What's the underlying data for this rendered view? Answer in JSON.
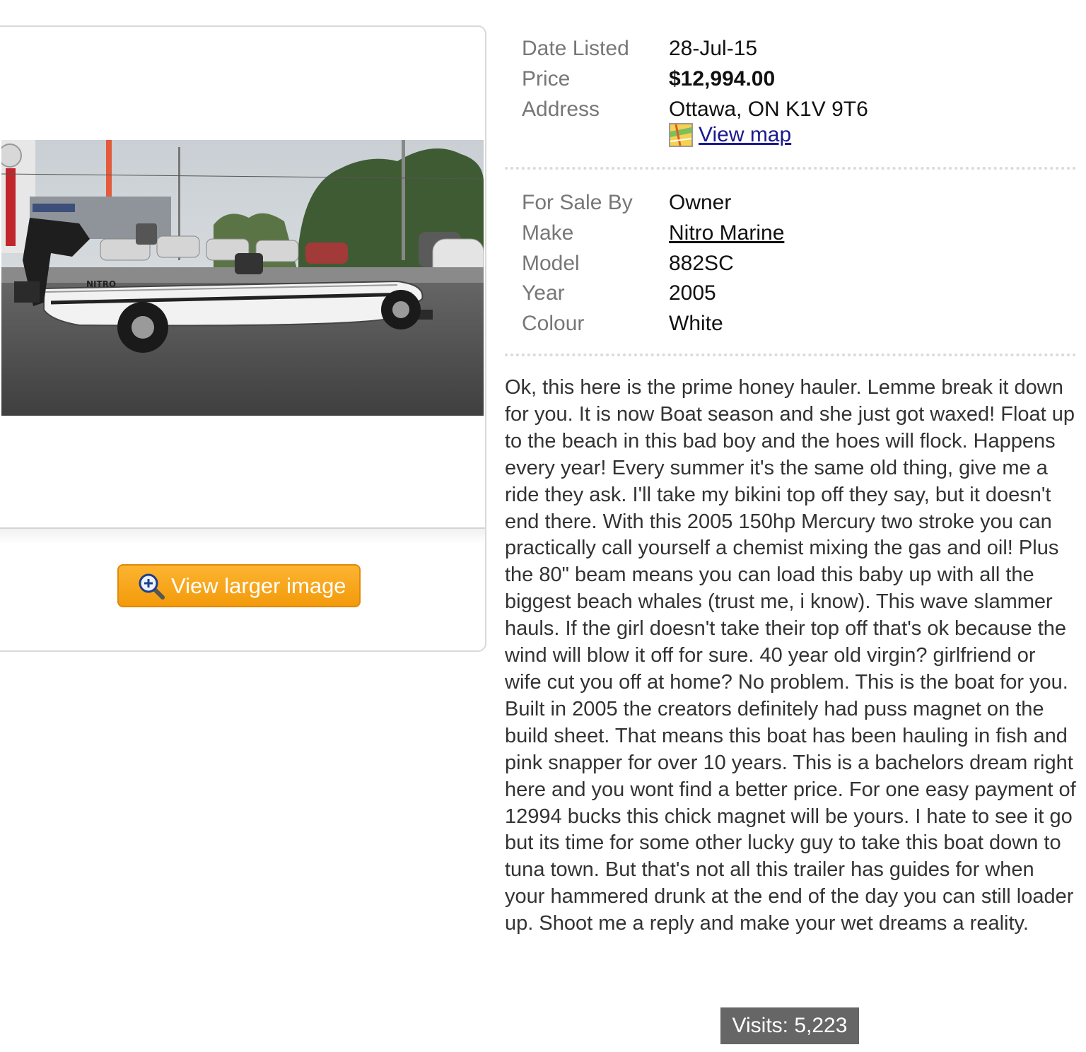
{
  "gallery": {
    "photo_alt": "",
    "view_larger_label": "View larger image"
  },
  "listing": {
    "date_listed": {
      "label": "Date Listed",
      "value": "28-Jul-15"
    },
    "price": {
      "label": "Price",
      "value": "$12,994.00"
    },
    "address": {
      "label": "Address",
      "value": "Ottawa, ON K1V 9T6",
      "map_link": "View map"
    },
    "for_sale_by": {
      "label": "For Sale By",
      "value": "Owner"
    },
    "make": {
      "label": "Make",
      "value": "Nitro Marine"
    },
    "model": {
      "label": "Model",
      "value": "882SC"
    },
    "year": {
      "label": "Year",
      "value": "2005"
    },
    "colour": {
      "label": "Colour",
      "value": "White"
    },
    "description": "Ok, this here is the prime honey hauler. Lemme break it down for you. It is now Boat season and she just got waxed! Float up to the beach in this bad boy and the hoes will flock. Happens every year! Every summer it's the same old thing, give me a ride they ask. I'll take my bikini top off they say, but it doesn't end there. With this 2005 150hp Mercury two stroke you can practically call yourself a chemist mixing the gas and oil! Plus the 80\" beam means you can load this baby up with all the biggest beach whales (trust me, i know). This wave slammer hauls. If the girl doesn't take their top off that's ok because the wind will blow it off for sure. 40 year old virgin? girlfriend or wife cut you off at home? No problem. This is the boat for you. Built in 2005 the creators definitely had puss magnet on the build sheet. That means this boat has been hauling in fish and pink snapper for over 10 years. This is a bachelors dream right here and you wont find a better price. For one easy payment of 12994 bucks this chick magnet will be yours. I hate to see it go but its time for some other lucky guy to take this boat down to tuna town. But that's not all this trailer has guides for when your hammered drunk at the end of the day you can still loader up. Shoot me a reply and make your wet dreams a reality.",
    "visits": "Visits: 5,223"
  },
  "colors": {
    "button_orange": "#f6a316",
    "link_blue": "#1a1a8e",
    "visits_bg": "#666666",
    "label_grey": "#777777"
  },
  "icons": {
    "zoom": "magnifier-plus-icon",
    "map": "map-icon"
  }
}
